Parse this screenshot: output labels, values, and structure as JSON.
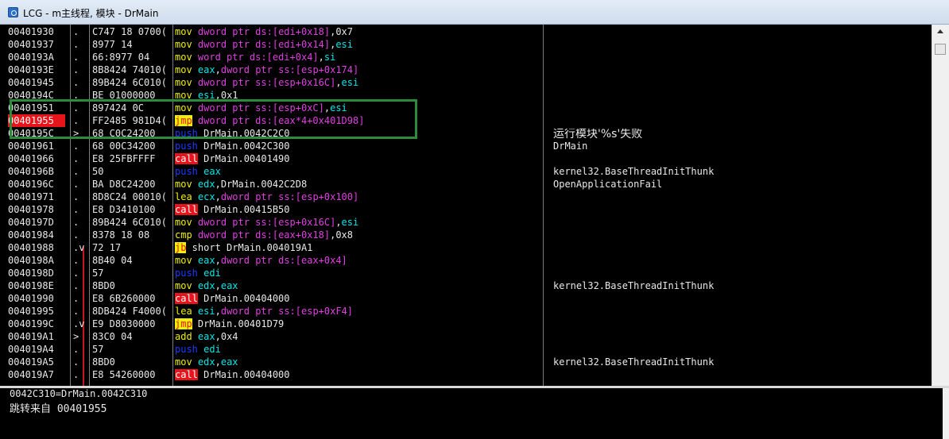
{
  "window": {
    "title": "LCG - m主线程, 模块 - DrMain"
  },
  "colors": {
    "mov": "#f0f000",
    "call_bg": "#e8141c",
    "call_fg": "#ffffff",
    "jmp_bg": "#f0f000",
    "jmp_fg": "#e8141c",
    "push": "#1a3cff",
    "lea": "#f0f000",
    "cmp": "#f0f000",
    "add": "#f0f000",
    "mem": "#e040e0",
    "reg": "#00e8e8",
    "num": "#e8e8e8",
    "text": "#e8e8e8",
    "selection_box": "#2c8c3c",
    "highlight_addr": "#e8141c"
  },
  "rows": [
    {
      "addr": "00401930",
      "mark": ".",
      "hex": "C747 18 0700(",
      "tokens": [
        [
          "mov",
          "mov"
        ],
        [
          " ",
          "t"
        ],
        [
          "dword ptr ds:[edi+0x18]",
          "mem"
        ],
        [
          ",",
          "t"
        ],
        [
          "0x7",
          "num"
        ]
      ],
      "comment": ""
    },
    {
      "addr": "00401937",
      "mark": ".",
      "hex": "8977 14",
      "tokens": [
        [
          "mov",
          "mov"
        ],
        [
          " ",
          "t"
        ],
        [
          "dword ptr ds:[edi+0x14]",
          "mem"
        ],
        [
          ",",
          "t"
        ],
        [
          "esi",
          "reg"
        ]
      ],
      "comment": ""
    },
    {
      "addr": "0040193A",
      "mark": ".",
      "hex": "66:8977 04",
      "tokens": [
        [
          "mov",
          "mov"
        ],
        [
          " ",
          "t"
        ],
        [
          "word ptr ds:[edi+0x4]",
          "mem"
        ],
        [
          ",",
          "t"
        ],
        [
          "si",
          "reg"
        ]
      ],
      "comment": ""
    },
    {
      "addr": "0040193E",
      "mark": ".",
      "hex": "8B8424 74010(",
      "tokens": [
        [
          "mov",
          "mov"
        ],
        [
          " ",
          "t"
        ],
        [
          "eax",
          "reg"
        ],
        [
          ",",
          "t"
        ],
        [
          "dword ptr ss:[esp+0x174]",
          "mem"
        ]
      ],
      "comment": ""
    },
    {
      "addr": "00401945",
      "mark": ".",
      "hex": "89B424 6C010(",
      "tokens": [
        [
          "mov",
          "mov"
        ],
        [
          " ",
          "t"
        ],
        [
          "dword ptr ss:[esp+0x16C]",
          "mem"
        ],
        [
          ",",
          "t"
        ],
        [
          "esi",
          "reg"
        ]
      ],
      "comment": ""
    },
    {
      "addr": "0040194C",
      "mark": ".",
      "hex": "BE 01000000",
      "tokens": [
        [
          "mov",
          "mov"
        ],
        [
          " ",
          "t"
        ],
        [
          "esi",
          "reg"
        ],
        [
          ",",
          "t"
        ],
        [
          "0x1",
          "num"
        ]
      ],
      "comment": ""
    },
    {
      "addr": "00401951",
      "mark": ".",
      "hex": "897424 0C",
      "tokens": [
        [
          "mov",
          "mov"
        ],
        [
          " ",
          "t"
        ],
        [
          "dword ptr ss:[esp+0xC]",
          "mem"
        ],
        [
          ",",
          "t"
        ],
        [
          "esi",
          "reg"
        ]
      ],
      "comment": ""
    },
    {
      "addr": "00401955",
      "mark": ".",
      "hex": "FF2485 981D4(",
      "tokens": [
        [
          "jmp",
          "jmp"
        ],
        [
          " ",
          "t"
        ],
        [
          "dword ptr ds:[eax*4+0x401D98]",
          "mem"
        ]
      ],
      "comment": "",
      "highlight": true
    },
    {
      "addr": "0040195C",
      "mark": ">",
      "hex": "68 C0C24200",
      "tokens": [
        [
          "push",
          "push"
        ],
        [
          " DrMain.0042C2C0",
          "t"
        ]
      ],
      "comment": "运行模块'%s'失败",
      "comment_big": true
    },
    {
      "addr": "00401961",
      "mark": ".",
      "hex": "68 00C34200",
      "tokens": [
        [
          "push",
          "push"
        ],
        [
          " DrMain.0042C300",
          "t"
        ]
      ],
      "comment": "DrMain"
    },
    {
      "addr": "00401966",
      "mark": ".",
      "hex": "E8 25FBFFFF",
      "tokens": [
        [
          "call",
          "call"
        ],
        [
          " DrMain.00401490",
          "t"
        ]
      ],
      "comment": ""
    },
    {
      "addr": "0040196B",
      "mark": ".",
      "hex": "50",
      "tokens": [
        [
          "push",
          "push"
        ],
        [
          " ",
          "t"
        ],
        [
          "eax",
          "reg"
        ]
      ],
      "comment": "kernel32.BaseThreadInitThunk"
    },
    {
      "addr": "0040196C",
      "mark": ".",
      "hex": "BA D8C24200",
      "tokens": [
        [
          "mov",
          "mov"
        ],
        [
          " ",
          "t"
        ],
        [
          "edx",
          "reg"
        ],
        [
          ",DrMain.0042C2D8",
          "t"
        ]
      ],
      "comment": "OpenApplicationFail"
    },
    {
      "addr": "00401971",
      "mark": ".",
      "hex": "8D8C24 00010(",
      "tokens": [
        [
          "lea",
          "lea"
        ],
        [
          " ",
          "t"
        ],
        [
          "ecx",
          "reg"
        ],
        [
          ",",
          "t"
        ],
        [
          "dword ptr ss:[esp+0x100]",
          "mem"
        ]
      ],
      "comment": ""
    },
    {
      "addr": "00401978",
      "mark": ".",
      "hex": "E8 D3410100",
      "tokens": [
        [
          "call",
          "call"
        ],
        [
          " DrMain.00415B50",
          "t"
        ]
      ],
      "comment": ""
    },
    {
      "addr": "0040197D",
      "mark": ".",
      "hex": "89B424 6C010(",
      "tokens": [
        [
          "mov",
          "mov"
        ],
        [
          " ",
          "t"
        ],
        [
          "dword ptr ss:[esp+0x16C]",
          "mem"
        ],
        [
          ",",
          "t"
        ],
        [
          "esi",
          "reg"
        ]
      ],
      "comment": ""
    },
    {
      "addr": "00401984",
      "mark": ".",
      "hex": "8378 18 08",
      "tokens": [
        [
          "cmp",
          "cmp"
        ],
        [
          " ",
          "t"
        ],
        [
          "dword ptr ds:[eax+0x18]",
          "mem"
        ],
        [
          ",",
          "t"
        ],
        [
          "0x8",
          "num"
        ]
      ],
      "comment": ""
    },
    {
      "addr": "00401988",
      "mark": ".v",
      "hex": "72 17",
      "tokens": [
        [
          "jb",
          "jmp"
        ],
        [
          " short DrMain.004019A1",
          "t"
        ]
      ],
      "comment": ""
    },
    {
      "addr": "0040198A",
      "mark": ".",
      "hex": "8B40 04",
      "tokens": [
        [
          "mov",
          "mov"
        ],
        [
          " ",
          "t"
        ],
        [
          "eax",
          "reg"
        ],
        [
          ",",
          "t"
        ],
        [
          "dword ptr ds:[eax+0x4]",
          "mem"
        ]
      ],
      "comment": ""
    },
    {
      "addr": "0040198D",
      "mark": ".",
      "hex": "57",
      "tokens": [
        [
          "push",
          "push"
        ],
        [
          " ",
          "t"
        ],
        [
          "edi",
          "reg"
        ]
      ],
      "comment": ""
    },
    {
      "addr": "0040198E",
      "mark": ".",
      "hex": "8BD0",
      "tokens": [
        [
          "mov",
          "mov"
        ],
        [
          " ",
          "t"
        ],
        [
          "edx",
          "reg"
        ],
        [
          ",",
          "t"
        ],
        [
          "eax",
          "reg"
        ]
      ],
      "comment": "kernel32.BaseThreadInitThunk"
    },
    {
      "addr": "00401990",
      "mark": ".",
      "hex": "E8 6B260000",
      "tokens": [
        [
          "call",
          "call"
        ],
        [
          " DrMain.00404000",
          "t"
        ]
      ],
      "comment": ""
    },
    {
      "addr": "00401995",
      "mark": ".",
      "hex": "8DB424 F4000(",
      "tokens": [
        [
          "lea",
          "lea"
        ],
        [
          " ",
          "t"
        ],
        [
          "esi",
          "reg"
        ],
        [
          ",",
          "t"
        ],
        [
          "dword ptr ss:[esp+0xF4]",
          "mem"
        ]
      ],
      "comment": ""
    },
    {
      "addr": "0040199C",
      "mark": ".v",
      "hex": "E9 D8030000",
      "tokens": [
        [
          "jmp",
          "jmp"
        ],
        [
          " DrMain.00401D79",
          "t"
        ]
      ],
      "comment": ""
    },
    {
      "addr": "004019A1",
      "mark": ">",
      "hex": "83C0 04",
      "tokens": [
        [
          "add",
          "add"
        ],
        [
          " ",
          "t"
        ],
        [
          "eax",
          "reg"
        ],
        [
          ",",
          "t"
        ],
        [
          "0x4",
          "num"
        ]
      ],
      "comment": ""
    },
    {
      "addr": "004019A4",
      "mark": ".",
      "hex": "57",
      "tokens": [
        [
          "push",
          "push"
        ],
        [
          " ",
          "t"
        ],
        [
          "edi",
          "reg"
        ]
      ],
      "comment": ""
    },
    {
      "addr": "004019A5",
      "mark": ".",
      "hex": "8BD0",
      "tokens": [
        [
          "mov",
          "mov"
        ],
        [
          " ",
          "t"
        ],
        [
          "edx",
          "reg"
        ],
        [
          ",",
          "t"
        ],
        [
          "eax",
          "reg"
        ]
      ],
      "comment": "kernel32.BaseThreadInitThunk"
    },
    {
      "addr": "004019A7",
      "mark": ".",
      "hex": "E8 54260000",
      "tokens": [
        [
          "call",
          "call"
        ],
        [
          " DrMain.00404000",
          "t"
        ]
      ],
      "comment": ""
    }
  ],
  "info": {
    "line1": "0042C310=DrMain.0042C310",
    "line2": "跳转来自 00401955"
  },
  "icons": {
    "app": "lcg-app-icon",
    "scroll_up": "scroll-up-arrow-icon"
  }
}
